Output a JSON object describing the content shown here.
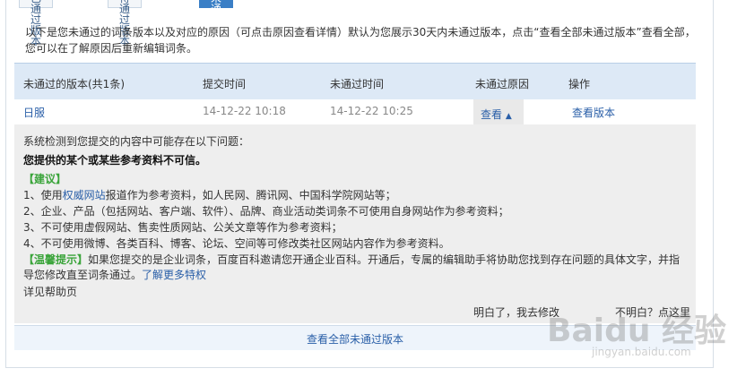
{
  "tabs": [
    {
      "label": "已通过版本"
    },
    {
      "label": "待通过版本"
    },
    {
      "label": "未通过版本"
    }
  ],
  "intro": "以下是您未通过的词条版本以及对应的原因（可点击原因查看详情）默认为您展示30天内未通过版本，点击“查看全部未通过版本”查看全部，您可以在了解原因后重新编辑词条。",
  "table": {
    "headers": [
      "未通过的版本(共1条)",
      "提交时间",
      "未通过时间",
      "未通过原因",
      "操作"
    ],
    "row": {
      "name": "日服",
      "submit_time": "14-12-22 10:18",
      "fail_time": "14-12-22 10:25",
      "reason_btn": "查看",
      "action": "查看版本"
    }
  },
  "panel": {
    "line1": "系统检测到您提交的内容中可能存在以下问题：",
    "line2": "您提供的某个或某些参考资料不可信。",
    "suggest_label": "【建议】",
    "s1_pre": "1、使用",
    "s1_link": "权威网站",
    "s1_post": "报道作为参考资料，如人民网、腾讯网、中国科学院网站等；",
    "s2": "2、企业、产品（包括网站、客户端、软件）、品牌、商业活动类词条不可使用自身网站作为参考资料；",
    "s3": "3、不可使用虚假网站、售卖性质网站、公关文章等作为参考资料；",
    "s4": "4、不可使用微博、各类百科、博客、论坛、空间等可修改类社区网站内容作为参考资料。",
    "tip_label": "【温馨提示】",
    "tip_text": "如果您提交的是企业词条，百度百科邀请您开通企业百科。开通后，专属的编辑助手将协助您找到存在问题的具体文字，并指导您修改直至词条通过。",
    "tip_link": "了解更多特权",
    "help_link": "详见帮助页",
    "understood": "明白了，我去修改",
    "not_understood": "不明白？点这里"
  },
  "footer": {
    "label": "查看全部未通过版本"
  },
  "watermark": {
    "text": "Baidu 经验",
    "sub": "jingyan.baidu.com"
  }
}
